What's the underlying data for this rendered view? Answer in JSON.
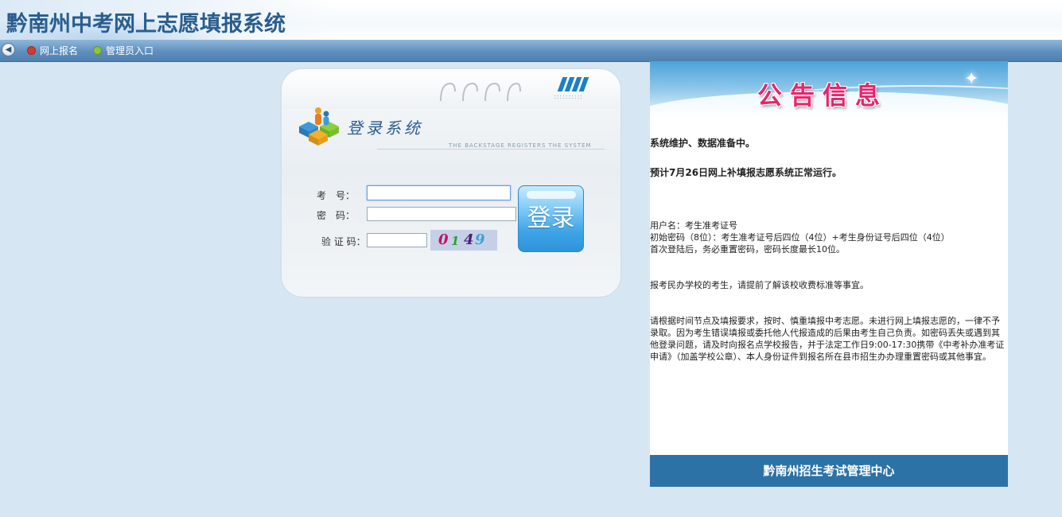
{
  "header": {
    "title": "黔南州中考网上志愿填报系统"
  },
  "nav": {
    "items": [
      {
        "label": "网上报名",
        "dot_color": "#d83a2a"
      },
      {
        "label": "管理员入口",
        "dot_color": "#8cc63a"
      }
    ]
  },
  "login": {
    "title": "登录系统",
    "subtitle": "THE BACKSTAGE REGISTERS THE SYSTEM",
    "fields": {
      "exam_no_label": "考　号：",
      "password_label": "密　码：",
      "captcha_label": "验 证 码："
    },
    "captcha_chars": [
      "0",
      "1",
      "4",
      "9"
    ],
    "button_label": "登录"
  },
  "notice": {
    "banner_title": "公告信息",
    "lines": {
      "maintenance": "系统维护、数据准备中。",
      "schedule": "预计7月26日网上补填报志愿系统正常运行。",
      "username": "用户名：考生准考证号",
      "initial_password": "初始密码（8位）：考生准考证号后四位（4位）+考生身份证号后四位（4位）",
      "reset": "首次登陆后，务必重置密码，密码长度最长10位。",
      "private_school": "报考民办学校的考生，请提前了解该校收费标准等事宜。",
      "deadline": "请根据时间节点及填报要求，按时、慎重填报中考志愿。未进行网上填报志愿的，一律不予录取。因为考生错误填报或委托他人代报造成的后果由考生自己负责。如密码丢失或遇到其他登录问题，请及时向报名点学校报告，并于法定工作日9:00-17:30携带《中考补办准考证申请》（加盖学校公章）、本人身份证件到报名所在县市招生办办理重置密码或其他事宜。"
    },
    "footer": "黔南州招生考试管理中心"
  },
  "colors": {
    "accent": "#2a5d8e",
    "notice_title": "#e8256f",
    "footer_bg": "#2c72a6",
    "button": "#3fa4e6"
  }
}
